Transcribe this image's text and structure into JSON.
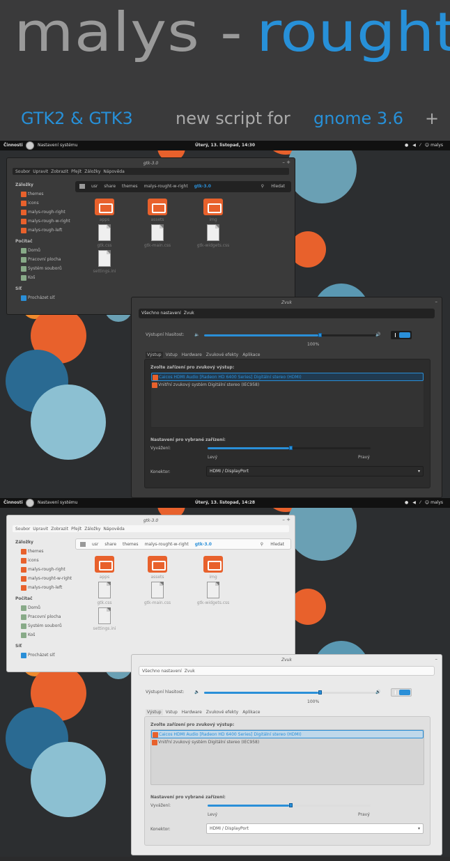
{
  "header": {
    "title_left": "malys -",
    "title_right": "rought",
    "sub_gtk": "GTK2 & GTK3",
    "sub_script": "new script for",
    "sub_gnome": "gnome 3.6",
    "sub_plus": "+"
  },
  "colors": {
    "accent": "#2a8fd8",
    "orange": "#e8612c",
    "bg": "#2c2e30"
  },
  "shots": [
    {
      "theme": "dark",
      "topbar": {
        "activities": "Činnosti",
        "app": "Nastavení systému",
        "clock": "Úterý, 13. listopad, 14:30",
        "user": "malys"
      },
      "files": {
        "title": "gtk-3.0",
        "menu": [
          "Soubor",
          "Upravit",
          "Zobrazit",
          "Přejít",
          "Záložky",
          "Nápověda"
        ],
        "sidebar": {
          "bookmarks_header": "Záložky",
          "bookmarks": [
            "themes",
            "icons",
            "malys-rough-right",
            "malys-rough-w-right",
            "malys-rough-left"
          ],
          "computer_header": "Počítač",
          "computer": [
            "Domů",
            "Pracovní plocha",
            "Systém souborů",
            "Koš"
          ],
          "network_header": "Síť",
          "network": [
            "Procházet síť"
          ]
        },
        "path": [
          "usr",
          "share",
          "themes",
          "malys-rought-w-right",
          "gtk-3.0"
        ],
        "search": "Hledat",
        "items": [
          "apps",
          "assets",
          "img",
          "gtk.css",
          "gtk-main.css",
          "gtk-widgets.css",
          "settings.ini"
        ]
      },
      "sound": {
        "title": "Zvuk",
        "all_settings": "Všechno nastavení",
        "section": "Zvuk",
        "volume_label": "Výstupní hlasitost:",
        "volume_pct": "100%",
        "volume": 1.0,
        "tabs": [
          "Výstup",
          "Vstup",
          "Hardware",
          "Zvukové efekty",
          "Aplikace"
        ],
        "choose": "Zvolte zařízení pro zvukový výstup:",
        "devices": [
          "Caicos HDMI Audio [Radeon HD 6400 Series] Digitální stereo (HDMI)",
          "Vnitřní zvukový systém Digitální stereo (IEC958)"
        ],
        "selected_settings": "Nastavení pro vybrané zařízení:",
        "balance_label": "Vyvážení:",
        "balance": 0.5,
        "left": "Levý",
        "right": "Pravý",
        "connector_label": "Konektor:",
        "connector": "HDMI / DisplayPort"
      }
    },
    {
      "theme": "light",
      "topbar": {
        "activities": "Činnosti",
        "app": "Nastavení systému",
        "clock": "Úterý, 13. listopad, 14:28",
        "user": "malys"
      },
      "files": {
        "title": "gtk-3.0",
        "menu": [
          "Soubor",
          "Upravit",
          "Zobrazit",
          "Přejít",
          "Záložky",
          "Nápověda"
        ],
        "sidebar": {
          "bookmarks_header": "Záložky",
          "bookmarks": [
            "themes",
            "icons",
            "malys-rough-right",
            "malys-rought-w-right",
            "malys-rough-left"
          ],
          "computer_header": "Počítač",
          "computer": [
            "Domů",
            "Pracovní plocha",
            "Systém souborů",
            "Koš"
          ],
          "network_header": "Síť",
          "network": [
            "Procházet síť"
          ]
        },
        "path": [
          "usr",
          "share",
          "themes",
          "malys-rought-w-right",
          "gtk-3.0"
        ],
        "search": "Hledat",
        "items": [
          "apps",
          "assets",
          "img",
          "gtk.css",
          "gtk-main.css",
          "gtk-widgets.css",
          "settings.ini"
        ]
      },
      "sound": {
        "title": "Zvuk",
        "all_settings": "Všechno nastavení",
        "section": "Zvuk",
        "volume_label": "Výstupní hlasitost:",
        "volume_pct": "100%",
        "volume": 1.0,
        "tabs": [
          "Výstup",
          "Vstup",
          "Hardware",
          "Zvukové efekty",
          "Aplikace"
        ],
        "choose": "Zvolte zařízení pro zvukový výstup:",
        "devices": [
          "Caicos HDMI Audio [Radeon HD 6400 Series] Digitální stereo (HDMI)",
          "Vnitřní zvukový systém Digitální stereo (IEC958)"
        ],
        "selected_settings": "Nastavení pro vybrané zařízení:",
        "balance_label": "Vyvážení:",
        "balance": 0.5,
        "left": "Levý",
        "right": "Pravý",
        "connector_label": "Konektor:",
        "connector": "HDMI / DisplayPort"
      }
    }
  ]
}
